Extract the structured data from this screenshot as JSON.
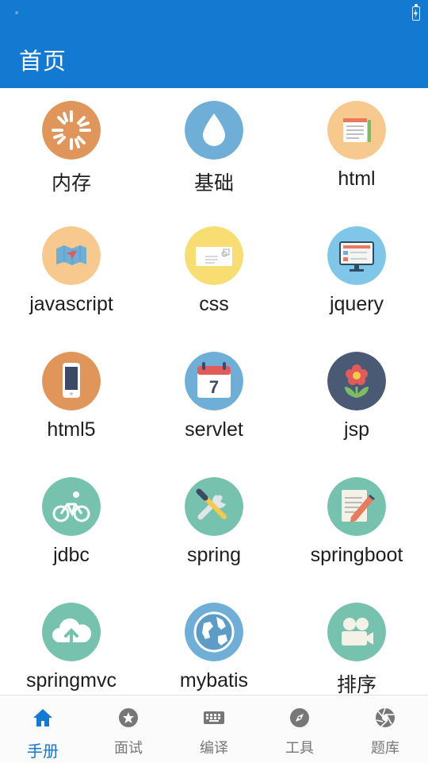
{
  "app": {
    "title": "首页"
  },
  "colors": {
    "primary": "#1479D1",
    "nav_inactive": "#777777"
  },
  "grid": {
    "items": [
      {
        "label": "内存",
        "icon": "sun-burst-icon",
        "bg": "#E0965A"
      },
      {
        "label": "基础",
        "icon": "water-drop-icon",
        "bg": "#6FAFD7"
      },
      {
        "label": "html",
        "icon": "document-icon",
        "bg": "#F7C98F"
      },
      {
        "label": "javascript",
        "icon": "map-icon",
        "bg": "#F7C98F"
      },
      {
        "label": "css",
        "icon": "envelope-icon",
        "bg": "#F7DD72"
      },
      {
        "label": "jquery",
        "icon": "monitor-icon",
        "bg": "#7FC6E8"
      },
      {
        "label": "html5",
        "icon": "phone-icon",
        "bg": "#E0965A"
      },
      {
        "label": "servlet",
        "icon": "calendar-icon",
        "bg": "#6FAFD7"
      },
      {
        "label": "jsp",
        "icon": "flower-icon",
        "bg": "#4A5A75"
      },
      {
        "label": "jdbc",
        "icon": "bicycle-icon",
        "bg": "#76C2AF"
      },
      {
        "label": "spring",
        "icon": "tools-icon",
        "bg": "#76C2AF"
      },
      {
        "label": "springboot",
        "icon": "pencil-note-icon",
        "bg": "#76C2AF"
      },
      {
        "label": "springmvc",
        "icon": "cloud-upload-icon",
        "bg": "#76C2AF"
      },
      {
        "label": "mybatis",
        "icon": "globe-icon",
        "bg": "#6FAFD7"
      },
      {
        "label": "排序",
        "icon": "video-camera-icon",
        "bg": "#76C2AF"
      }
    ]
  },
  "bottom_nav": {
    "items": [
      {
        "label": "手册",
        "icon": "home-icon",
        "active": true
      },
      {
        "label": "面试",
        "icon": "star-icon",
        "active": false
      },
      {
        "label": "编译",
        "icon": "keyboard-icon",
        "active": false
      },
      {
        "label": "工具",
        "icon": "compass-icon",
        "active": false
      },
      {
        "label": "题库",
        "icon": "aperture-icon",
        "active": false
      }
    ]
  }
}
